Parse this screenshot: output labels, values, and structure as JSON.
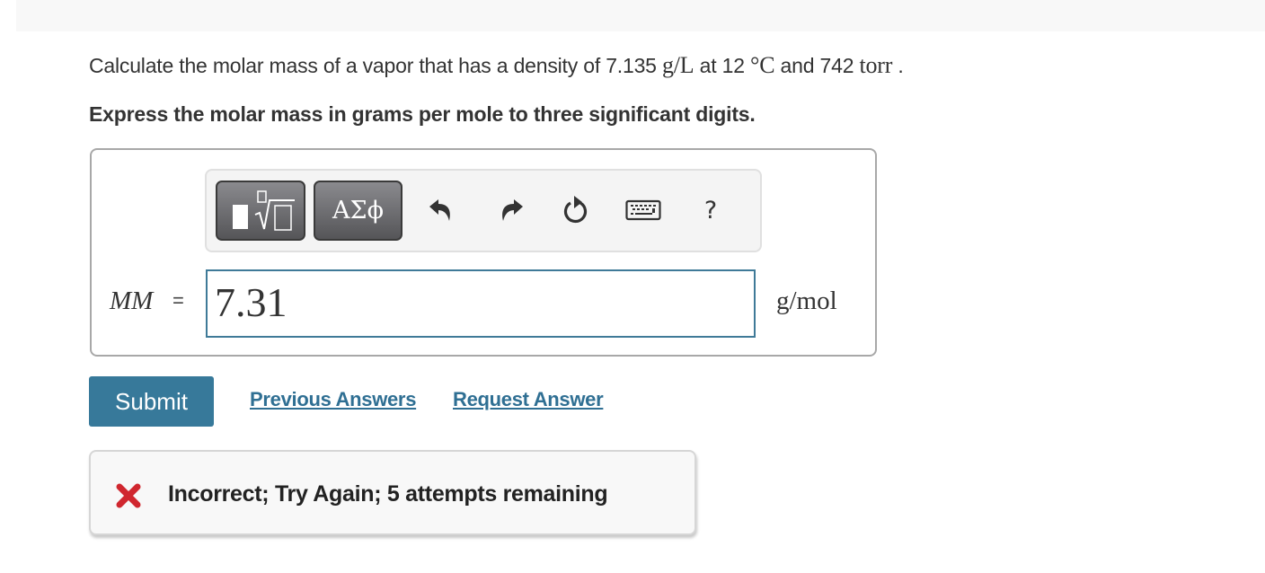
{
  "question": {
    "prefix": "Calculate the molar mass of a vapor that has a density of 7.135 ",
    "density_unit": "g/L",
    "mid1": " at 12 ",
    "temp_unit": "°C",
    "mid2": " and 742 ",
    "pressure_unit": "torr",
    "suffix": " ."
  },
  "instruction": "Express the molar mass in grams per mole to three significant digits.",
  "toolbar": {
    "templates_icon": "templates-sqrt-icon",
    "greek_label": "ΑΣϕ",
    "undo_icon": "undo-icon",
    "redo_icon": "redo-icon",
    "reset_icon": "reset-icon",
    "keyboard_icon": "keyboard-icon",
    "help_label": "?"
  },
  "answer": {
    "variable_label": "MM",
    "equals": "=",
    "value": "7.31",
    "unit": "g/mol"
  },
  "actions": {
    "submit_label": "Submit",
    "previous_answers_label": "Previous Answers",
    "request_answer_label": "Request Answer"
  },
  "feedback": {
    "icon": "x-mark-icon",
    "message": "Incorrect; Try Again; 5 attempts remaining",
    "status_color": "#d0272f"
  },
  "colors": {
    "accent": "#37799a",
    "link": "#2f6f93",
    "input_border": "#3f7a98"
  }
}
